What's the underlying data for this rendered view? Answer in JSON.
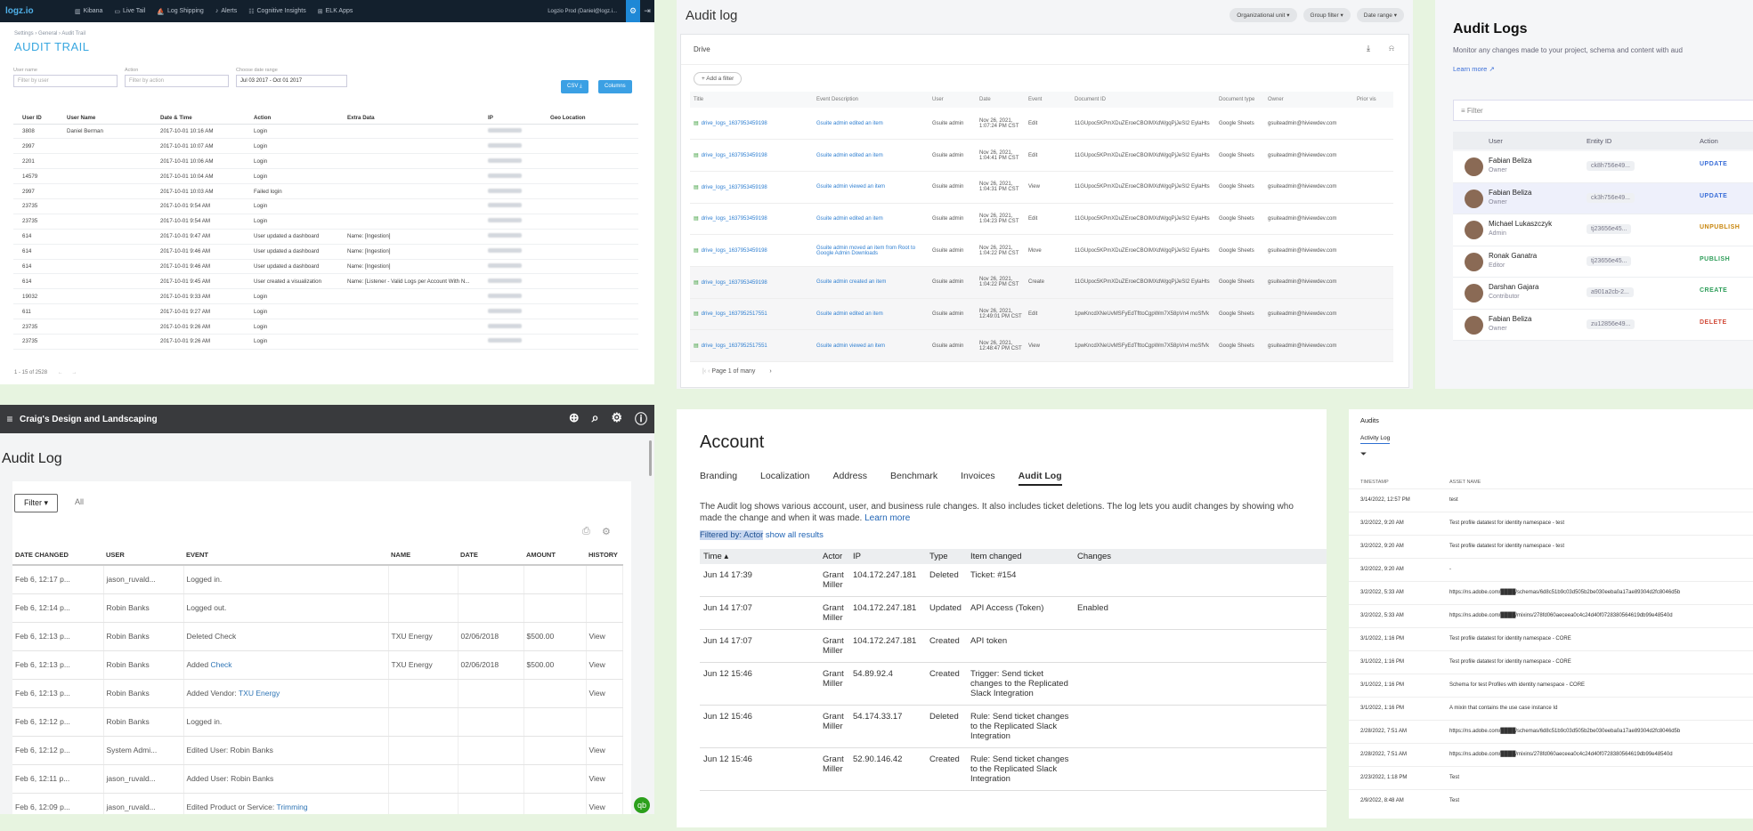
{
  "p1": {
    "logo": "logz.io",
    "nav": [
      "Kibana",
      "Live Tail",
      "Log Shipping",
      "Alerts",
      "Cognitive Insights",
      "ELK Apps"
    ],
    "user": "Logzio Prod (Daniel@logz.i...",
    "breadcrumb": "Settings › General › Audit Trail",
    "title": "AUDIT TRAIL",
    "filters": {
      "user_label": "User name",
      "user_ph": "Filter by user",
      "action_label": "Action",
      "action_ph": "Filter by action",
      "date_label": "Choose date range",
      "date_value": "Jul 03 2017 - Oct 01 2017"
    },
    "csv": "CSV ⤓",
    "columns": "Columns",
    "headers": [
      "User ID",
      "User Name",
      "Date & Time",
      "Action",
      "Extra Data",
      "IP",
      "Geo Location"
    ],
    "rows": [
      {
        "id": "3808",
        "name": "Daniel Berman",
        "date": "2017-10-01 10:16 AM",
        "action": "Login",
        "extra": ""
      },
      {
        "id": "2997",
        "name": "",
        "date": "2017-10-01 10:07 AM",
        "action": "Login",
        "extra": ""
      },
      {
        "id": "2201",
        "name": "",
        "date": "2017-10-01 10:06 AM",
        "action": "Login",
        "extra": ""
      },
      {
        "id": "14579",
        "name": "",
        "date": "2017-10-01 10:04 AM",
        "action": "Login",
        "extra": ""
      },
      {
        "id": "2997",
        "name": "",
        "date": "2017-10-01 10:03 AM",
        "action": "Failed login",
        "extra": ""
      },
      {
        "id": "23735",
        "name": "",
        "date": "2017-10-01 9:54 AM",
        "action": "Login",
        "extra": ""
      },
      {
        "id": "23735",
        "name": "",
        "date": "2017-10-01 9:54 AM",
        "action": "Login",
        "extra": ""
      },
      {
        "id": "614",
        "name": "",
        "date": "2017-10-01 9:47 AM",
        "action": "User updated a dashboard",
        "extra": "Name: [Ingestion]"
      },
      {
        "id": "614",
        "name": "",
        "date": "2017-10-01 9:46 AM",
        "action": "User updated a dashboard",
        "extra": "Name: [Ingestion]"
      },
      {
        "id": "614",
        "name": "",
        "date": "2017-10-01 9:46 AM",
        "action": "User updated a dashboard",
        "extra": "Name: [Ingestion]"
      },
      {
        "id": "614",
        "name": "",
        "date": "2017-10-01 9:45 AM",
        "action": "User created a visualization",
        "extra": "Name: [Listener - Valid Logs per Account With N..."
      },
      {
        "id": "19032",
        "name": "",
        "date": "2017-10-01 9:33 AM",
        "action": "Login",
        "extra": ""
      },
      {
        "id": "611",
        "name": "",
        "date": "2017-10-01 9:27 AM",
        "action": "Login",
        "extra": ""
      },
      {
        "id": "23735",
        "name": "",
        "date": "2017-10-01 9:26 AM",
        "action": "Login",
        "extra": ""
      },
      {
        "id": "23735",
        "name": "",
        "date": "2017-10-01 9:26 AM",
        "action": "Login",
        "extra": ""
      }
    ],
    "footer": "1 - 15 of 2528"
  },
  "p2": {
    "title": "Audit log",
    "chips": [
      "Organizational unit",
      "Group filter",
      "Date range"
    ],
    "drive": "Drive",
    "add_filter": "Add a filter",
    "headers": [
      "Title",
      "Event Description",
      "User",
      "Date",
      "Event",
      "Document ID",
      "Document type",
      "Owner",
      "Prior vis"
    ],
    "rows": [
      {
        "title": "drive_logs_1637953459198",
        "desc": "Gsuite admin edited an item",
        "user": "Gsuite admin",
        "date": "Nov 26, 2021, 1:07:24 PM CST",
        "event": "Edit",
        "doc": "11GUpoc5KPmXDuZEroeCBOIMXdWgqPjJeSI2 EylaHts",
        "type": "Google Sheets",
        "owner": "gsuiteadmin@hiviewdev.com"
      },
      {
        "title": "drive_logs_1637953459198",
        "desc": "Gsuite admin edited an item",
        "user": "Gsuite admin",
        "date": "Nov 26, 2021, 1:04:41 PM CST",
        "event": "Edit",
        "doc": "11GUpoc5KPmXDuZEroeCBOIMXdWgqPjJeSI2 EylaHts",
        "type": "Google Sheets",
        "owner": "gsuiteadmin@hiviewdev.com"
      },
      {
        "title": "drive_logs_1637953459198",
        "desc": "Gsuite admin viewed an item",
        "user": "Gsuite admin",
        "date": "Nov 26, 2021, 1:04:31 PM CST",
        "event": "View",
        "doc": "11GUpoc5KPmXDuZEroeCBOIMXdWgqPjJeSI2 EylaHts",
        "type": "Google Sheets",
        "owner": "gsuiteadmin@hiviewdev.com"
      },
      {
        "title": "drive_logs_1637953459198",
        "desc": "Gsuite admin edited an item",
        "user": "Gsuite admin",
        "date": "Nov 26, 2021, 1:04:23 PM CST",
        "event": "Edit",
        "doc": "11GUpoc5KPmXDuZEroeCBOIMXdWgqPjJeSI2 EylaHts",
        "type": "Google Sheets",
        "owner": "gsuiteadmin@hiviewdev.com"
      },
      {
        "title": "drive_logs_1637953459198",
        "desc": "Gsuite admin moved an item from Root to Google Admin Downloads",
        "user": "Gsuite admin",
        "date": "Nov 26, 2021, 1:04:22 PM CST",
        "event": "Move",
        "doc": "11GUpoc5KPmXDuZEroeCBOIMXdWgqPjJeSI2 EylaHts",
        "type": "Google Sheets",
        "owner": "gsuiteadmin@hiviewdev.com"
      },
      {
        "title": "drive_logs_1637953459198",
        "desc": "Gsuite admin created an item",
        "user": "Gsuite admin",
        "date": "Nov 26, 2021, 1:04:22 PM CST",
        "event": "Create",
        "doc": "11GUpoc5KPmXDuZEroeCBOIMXdWgqPjJeSI2 EylaHts",
        "type": "Google Sheets",
        "owner": "gsuiteadmin@hiviewdev.com"
      },
      {
        "title": "drive_logs_1637952517551",
        "desc": "Gsuite admin edited an item",
        "user": "Gsuite admin",
        "date": "Nov 26, 2021, 12:49:01 PM CST",
        "event": "Edit",
        "doc": "1pwKncdXNeUvMSFyEdTfttoCgpWm7X58pVn4 moSfVk",
        "type": "Google Sheets",
        "owner": "gsuiteadmin@hiviewdev.com"
      },
      {
        "title": "drive_logs_1637952517551",
        "desc": "Gsuite admin viewed an item",
        "user": "Gsuite admin",
        "date": "Nov 26, 2021, 12:48:47 PM CST",
        "event": "View",
        "doc": "1pwKncdXNeUvMSFyEdTfttoCgpWm7X58pVn4 moSfVk",
        "type": "Google Sheets",
        "owner": "gsuiteadmin@hiviewdev.com"
      }
    ],
    "pager": "Page 1 of many"
  },
  "p3": {
    "title": "Audit Logs",
    "subtitle": "Monitor any changes made to your project, schema and content with aud",
    "learn": "Learn more",
    "filter_ph": "Filter",
    "headers": [
      "User",
      "Entity ID",
      "Action"
    ],
    "rows": [
      {
        "name": "Fabian Beliza",
        "role": "Owner",
        "id": "ck8h756e49...",
        "action": "UPDATE",
        "color": "#3a6ed8"
      },
      {
        "name": "Fabian Beliza",
        "role": "Owner",
        "id": "ck3h756e49...",
        "action": "UPDATE",
        "color": "#3a6ed8"
      },
      {
        "name": "Michael Lukaszczyk",
        "role": "Admin",
        "id": "tj23656e45...",
        "action": "UNPUBLISH",
        "color": "#c8860d"
      },
      {
        "name": "Ronak Ganatra",
        "role": "Editor",
        "id": "tj23656e45...",
        "action": "PUBLISH",
        "color": "#2f9e5a"
      },
      {
        "name": "Darshan Gajara",
        "role": "Contributor",
        "id": "a901a2cb-2...",
        "action": "CREATE",
        "color": "#2f9e5a"
      },
      {
        "name": "Fabian Beliza",
        "role": "Owner",
        "id": "zu12856e49...",
        "action": "DELETE",
        "color": "#d14b3a"
      }
    ]
  },
  "p4": {
    "company": "Craig's Design and Landscaping",
    "title": "Audit Log",
    "filter": "Filter ▾",
    "all": "All",
    "headers": [
      "DATE CHANGED",
      "USER",
      "EVENT",
      "NAME",
      "DATE",
      "AMOUNT",
      "HISTORY"
    ],
    "rows": [
      {
        "d": "Feb 6, 12:17 p...",
        "u": "jason_ruvald...",
        "e": "Logged in.",
        "el": "",
        "n": "",
        "dt": "",
        "a": "",
        "h": ""
      },
      {
        "d": "Feb 6, 12:14 p...",
        "u": "Robin Banks",
        "e": "Logged out.",
        "el": "",
        "n": "",
        "dt": "",
        "a": "",
        "h": ""
      },
      {
        "d": "Feb 6, 12:13 p...",
        "u": "Robin Banks",
        "e": "Deleted Check",
        "el": "",
        "n": "TXU Energy",
        "dt": "02/06/2018",
        "a": "$500.00",
        "h": "View"
      },
      {
        "d": "Feb 6, 12:13 p...",
        "u": "Robin Banks",
        "e": "Added ",
        "el": "Check",
        "n": "TXU Energy",
        "dt": "02/06/2018",
        "a": "$500.00",
        "h": "View"
      },
      {
        "d": "Feb 6, 12:13 p...",
        "u": "Robin Banks",
        "e": "Added Vendor: ",
        "el": "TXU Energy",
        "n": "",
        "dt": "",
        "a": "",
        "h": "View"
      },
      {
        "d": "Feb 6, 12:12 p...",
        "u": "Robin Banks",
        "e": "Logged in.",
        "el": "",
        "n": "",
        "dt": "",
        "a": "",
        "h": ""
      },
      {
        "d": "Feb 6, 12:12 p...",
        "u": "System Admi...",
        "e": "Edited User: Robin Banks",
        "el": "",
        "n": "",
        "dt": "",
        "a": "",
        "h": "View"
      },
      {
        "d": "Feb 6, 12:11 p...",
        "u": "jason_ruvald...",
        "e": "Added User: Robin Banks",
        "el": "",
        "n": "",
        "dt": "",
        "a": "",
        "h": "View"
      },
      {
        "d": "Feb 6, 12:09 p...",
        "u": "jason_ruvald...",
        "e": "Edited Product or Service: ",
        "el": "Trimming",
        "n": "",
        "dt": "",
        "a": "",
        "h": "View"
      }
    ]
  },
  "p5": {
    "title": "Account",
    "tabs": [
      "Branding",
      "Localization",
      "Address",
      "Benchmark",
      "Invoices",
      "Audit Log"
    ],
    "desc": "The Audit log shows various account, user, and business rule changes. It also includes ticket deletions. The log lets you audit changes by showing who made the change and when it was made.",
    "learn": "Learn more",
    "filtered": "Filtered by: Actor",
    "show_all": "show all results",
    "headers": [
      "Time ▴",
      "Actor",
      "IP",
      "Type",
      "Item changed",
      "Changes"
    ],
    "rows": [
      {
        "t": "Jun 14 17:39",
        "actor": "Grant Miller",
        "ip": "104.172.247.181",
        "type": "Deleted",
        "item": "Ticket: #154",
        "ch": ""
      },
      {
        "t": "Jun 14 17:07",
        "actor": "Grant Miller",
        "ip": "104.172.247.181",
        "type": "Updated",
        "item": "API Access (Token)",
        "ch": "Enabled"
      },
      {
        "t": "Jun 14 17:07",
        "actor": "Grant Miller",
        "ip": "104.172.247.181",
        "type": "Created",
        "item": "API token",
        "ch": ""
      },
      {
        "t": "Jun 12 15:46",
        "actor": "Grant Miller",
        "ip": "54.89.92.4",
        "type": "Created",
        "item": "Trigger: Send ticket changes to the Replicated Slack Integration",
        "ch": ""
      },
      {
        "t": "Jun 12 15:46",
        "actor": "Grant Miller",
        "ip": "54.174.33.17",
        "type": "Deleted",
        "item": "Rule: Send ticket changes to the Replicated Slack Integration",
        "ch": ""
      },
      {
        "t": "Jun 12 15:46",
        "actor": "Grant Miller",
        "ip": "52.90.146.42",
        "type": "Created",
        "item": "Rule: Send ticket changes to the Replicated Slack Integration",
        "ch": ""
      }
    ]
  },
  "p6": {
    "title": "Audits",
    "tab": "Activity Log",
    "headers": [
      "TIMESTAMP",
      "ASSET NAME"
    ],
    "rows": [
      {
        "ts": "3/14/2022, 12:57 PM",
        "name": "test"
      },
      {
        "ts": "3/2/2022, 9:20 AM",
        "name": "Test profile datatest for identity namespace - test"
      },
      {
        "ts": "3/2/2022, 9:20 AM",
        "name": "Test profile datatest for identity namespace - test"
      },
      {
        "ts": "3/2/2022, 9:20 AM",
        "name": "-"
      },
      {
        "ts": "3/2/2022, 5:33 AM",
        "name": "https://ns.adobe.com/████/schemas/6d8c51b9c03d505b2be030eeba0a17ae89304d2fc8046d5b"
      },
      {
        "ts": "3/2/2022, 5:33 AM",
        "name": "https://ns.adobe.com/████/mixins/278fd060aeceea0c4c24d40f0728380564619db99e48540d"
      },
      {
        "ts": "3/1/2022, 1:16 PM",
        "name": "Test profile datatest for identity namespace - CORE"
      },
      {
        "ts": "3/1/2022, 1:16 PM",
        "name": "Test profile datatest for identity namespace - CORE"
      },
      {
        "ts": "3/1/2022, 1:16 PM",
        "name": "Schema for test Profiles with identity namespace - CORE"
      },
      {
        "ts": "3/1/2022, 1:16 PM",
        "name": "A mixin that contains the use case instance Id"
      },
      {
        "ts": "2/28/2022, 7:51 AM",
        "name": "https://ns.adobe.com/████/schemas/6d8c51b9c03d505b2be030eeba0a17ae89304d2fc8046d5b"
      },
      {
        "ts": "2/28/2022, 7:51 AM",
        "name": "https://ns.adobe.com/████/mixins/278fd060aeceea0c4c24d40f0728380564619db99e48540d"
      },
      {
        "ts": "2/23/2022, 1:18 PM",
        "name": "Test"
      },
      {
        "ts": "2/9/2022, 8:48 AM",
        "name": "Test"
      }
    ]
  }
}
